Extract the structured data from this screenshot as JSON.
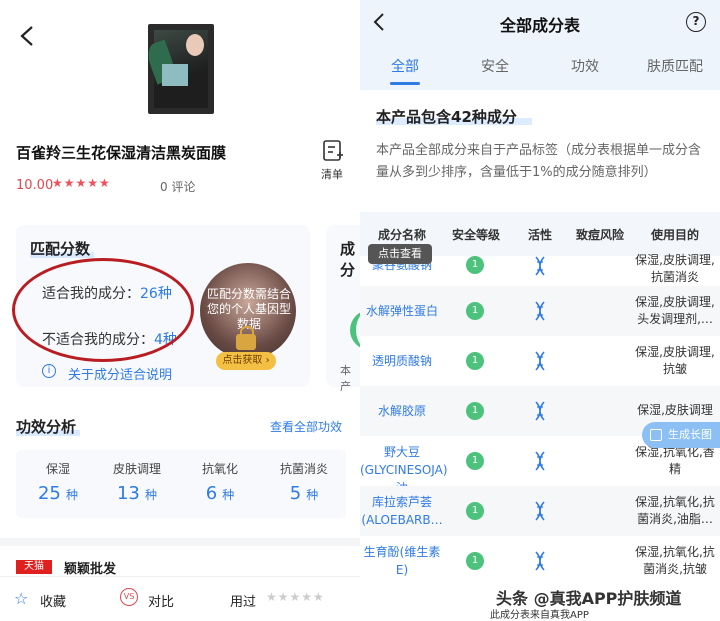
{
  "left": {
    "product_title": "百雀羚三生花保湿清洁黑炭面膜",
    "list_label": "清单",
    "score": "10.00",
    "stars": "★★★★★",
    "comments": "0 评论",
    "match": {
      "title": "匹配分数",
      "suit_label": "适合我的成分：",
      "suit_value": "26种",
      "unsuit_label": "不适合我的成分：",
      "unsuit_value": "4种",
      "info_link": "关于成分适合说明",
      "lock_text": "匹配分数需结合您的个人基因型数据",
      "get_button": "点击获取 ›"
    },
    "side_card": {
      "title": "成分",
      "text": "本产"
    },
    "efficacy": {
      "title": "功效分析",
      "link": "查看全部功效",
      "items": [
        {
          "label": "保湿",
          "num": "25",
          "unit": "种"
        },
        {
          "label": "皮肤调理",
          "num": "13",
          "unit": "种"
        },
        {
          "label": "抗氧化",
          "num": "6",
          "unit": "种"
        },
        {
          "label": "抗菌消炎",
          "num": "5",
          "unit": "种"
        }
      ]
    },
    "shop": {
      "badge": "天猫",
      "name": "颖颖批发"
    },
    "bottom": {
      "fav": "收藏",
      "compare": "对比",
      "compare_icon": "VS",
      "used": "用过",
      "used_stars": "★★★★★"
    }
  },
  "right": {
    "title": "全部成分表",
    "help": "?",
    "tabs": [
      "全部",
      "安全",
      "功效",
      "肤质匹配"
    ],
    "count_text": "本产品包含42种成分",
    "desc": "本产品全部成分来自于产品标签（成分表根据单一成分含量从多到少排序，含量低于1%的成分随意排列）",
    "headers": [
      "成分名称",
      "安全等级",
      "活性",
      "致痘风险",
      "使用目的"
    ],
    "tooltip": "点击查看",
    "rows": [
      {
        "name": "聚谷氨酸钠",
        "level": "1",
        "use": "保湿,皮肤调理,抗菌消炎"
      },
      {
        "name": "水解弹性蛋白",
        "level": "1",
        "use": "保湿,皮肤调理,头发调理剂,…"
      },
      {
        "name": "透明质酸钠",
        "level": "1",
        "use": "保湿,皮肤调理,抗皱"
      },
      {
        "name": "水解胶原",
        "level": "1",
        "use": "保湿,皮肤调理"
      },
      {
        "name": "野大豆(GLYCINESOJA)油",
        "level": "1",
        "use": "保湿,抗氧化,香精"
      },
      {
        "name": "库拉索芦荟(ALOEBARB…",
        "level": "1",
        "use": "保湿,抗氧化,抗菌消炎,油脂…"
      },
      {
        "name": "生育酚(维生素E)",
        "level": "1",
        "use": "保湿,抗氧化,抗菌消炎,抗皱"
      }
    ],
    "gen_button": "生成长图",
    "watermark": "头条 @真我APP护肤频道",
    "source_note": "此成分表来自真我APP"
  },
  "colors": {
    "accent": "#2f7be5",
    "safe": "#4cc27c",
    "highlight_red": "#b81d22",
    "header_bg": "#eef4fc"
  }
}
